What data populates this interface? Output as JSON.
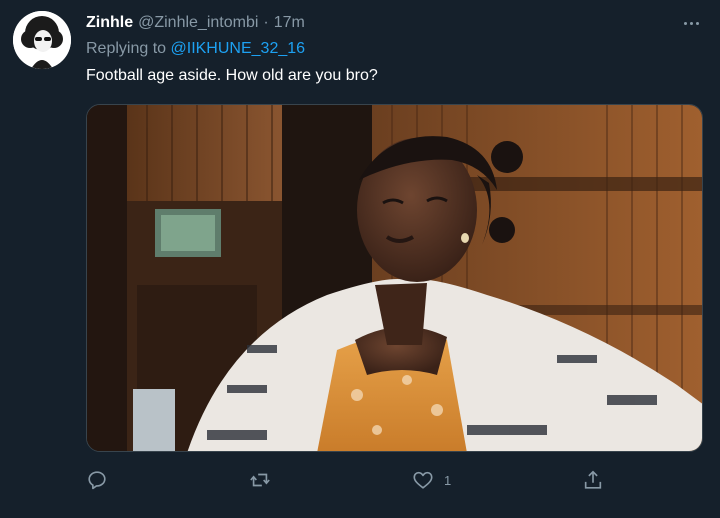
{
  "tweet": {
    "display_name": "Zinhle",
    "handle": "@Zinhle_intombi",
    "separator": "·",
    "time": "17m",
    "replying_prefix": "Replying to",
    "replying_to": "@IIKHUNE_32_16",
    "text": "Football age aside. How old are you bro?",
    "media_icon": "photo"
  },
  "actions": {
    "reply_icon": "reply-icon",
    "retweet_icon": "retweet-icon",
    "like_icon": "heart-icon",
    "like_count": "1",
    "share_icon": "share-icon"
  },
  "colors": {
    "background": "#15202b",
    "secondary_text": "#8899a6",
    "link": "#1da1f2"
  }
}
